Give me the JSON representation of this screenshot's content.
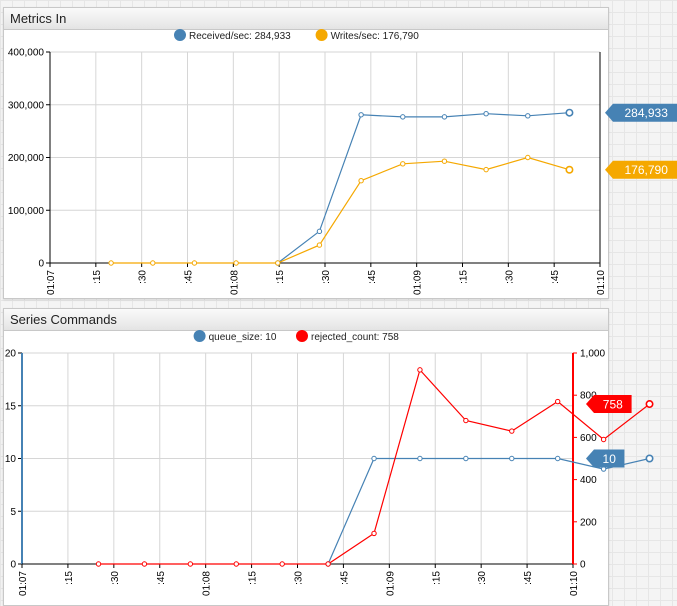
{
  "colors": {
    "received": "#4682b4",
    "writes": "#f5a800",
    "queue": "#4682b4",
    "rejected": "#ff0000"
  },
  "widgets": [
    {
      "title": "Metrics In",
      "chart_data": {
        "type": "line",
        "x": [
          "01:07:20",
          "01:07:35",
          "01:07:50",
          "01:08:05",
          "01:08:20",
          "01:08:35",
          "01:08:50",
          "01:09:05",
          "01:09:20",
          "01:09:35",
          "01:09:50"
        ],
        "x_ticks": [
          {
            "t": "01:07:00",
            "label": "01:07"
          },
          {
            "t": "01:07:15",
            "label": ":15"
          },
          {
            "t": "01:07:30",
            "label": ":30"
          },
          {
            "t": "01:07:45",
            "label": ":45"
          },
          {
            "t": "01:08:00",
            "label": "01:08"
          },
          {
            "t": "01:08:15",
            "label": ":15"
          },
          {
            "t": "01:08:30",
            "label": ":30"
          },
          {
            "t": "01:08:45",
            "label": ":45"
          },
          {
            "t": "01:09:00",
            "label": "01:09"
          },
          {
            "t": "01:09:15",
            "label": ":15"
          },
          {
            "t": "01:09:30",
            "label": ":30"
          },
          {
            "t": "01:09:45",
            "label": ":45"
          },
          {
            "t": "01:10:00",
            "label": "01:10"
          }
        ],
        "xlim": [
          "01:07:00",
          "01:10:00"
        ],
        "ylim": [
          0,
          400000
        ],
        "y_ticks": [
          "0",
          "100,000",
          "200,000",
          "300,000",
          "400,000"
        ],
        "grid": true,
        "legend_position": "top-center",
        "series": [
          {
            "name": "Received/sec",
            "legend": "Received/sec: 284,933",
            "color": "#4682b4",
            "axis": "left",
            "values": [
              null,
              null,
              null,
              null,
              0,
              60000,
              281000,
              277000,
              277000,
              283000,
              279000,
              284933
            ],
            "badge": "284,933"
          },
          {
            "name": "Writes/sec",
            "legend": "Writes/sec: 176,790",
            "color": "#f5a800",
            "axis": "left",
            "values": [
              0,
              0,
              0,
              0,
              0,
              34000,
              156000,
              188000,
              193000,
              177000,
              200000,
              176790
            ],
            "badge": "176,790"
          }
        ]
      }
    },
    {
      "title": "Series Commands",
      "chart_data": {
        "type": "line",
        "x_ticks": [
          {
            "t": "01:07:00",
            "label": "01:07"
          },
          {
            "t": "01:07:15",
            "label": ":15"
          },
          {
            "t": "01:07:30",
            "label": ":30"
          },
          {
            "t": "01:07:45",
            "label": ":45"
          },
          {
            "t": "01:08:00",
            "label": "01:08"
          },
          {
            "t": "01:08:15",
            "label": ":15"
          },
          {
            "t": "01:08:30",
            "label": ":30"
          },
          {
            "t": "01:08:45",
            "label": ":45"
          },
          {
            "t": "01:09:00",
            "label": "01:09"
          },
          {
            "t": "01:09:15",
            "label": ":15"
          },
          {
            "t": "01:09:30",
            "label": ":30"
          },
          {
            "t": "01:09:45",
            "label": ":45"
          },
          {
            "t": "01:10:00",
            "label": "01:10"
          }
        ],
        "xlim": [
          "01:07:00",
          "01:10:00"
        ],
        "ylim": [
          0,
          20
        ],
        "y_ticks": [
          "0",
          "5",
          "10",
          "15",
          "20"
        ],
        "y2lim": [
          0,
          1000
        ],
        "y2_ticks": [
          "0",
          "200",
          "400",
          "600",
          "800",
          "1,000"
        ],
        "grid": true,
        "legend_position": "top-center",
        "series": [
          {
            "name": "queue_size",
            "legend": "queue_size: 10",
            "color": "#4682b4",
            "axis": "left",
            "values": [
              null,
              null,
              null,
              null,
              null,
              0,
              10,
              10,
              10,
              10,
              10,
              9,
              10
            ],
            "badge": "10"
          },
          {
            "name": "rejected_count",
            "legend": "rejected_count: 758",
            "color": "#ff0000",
            "axis": "right",
            "values": [
              0,
              0,
              0,
              0,
              0,
              0,
              145,
              920,
              680,
              630,
              770,
              590,
              758
            ],
            "badge": "758"
          }
        ]
      }
    }
  ]
}
